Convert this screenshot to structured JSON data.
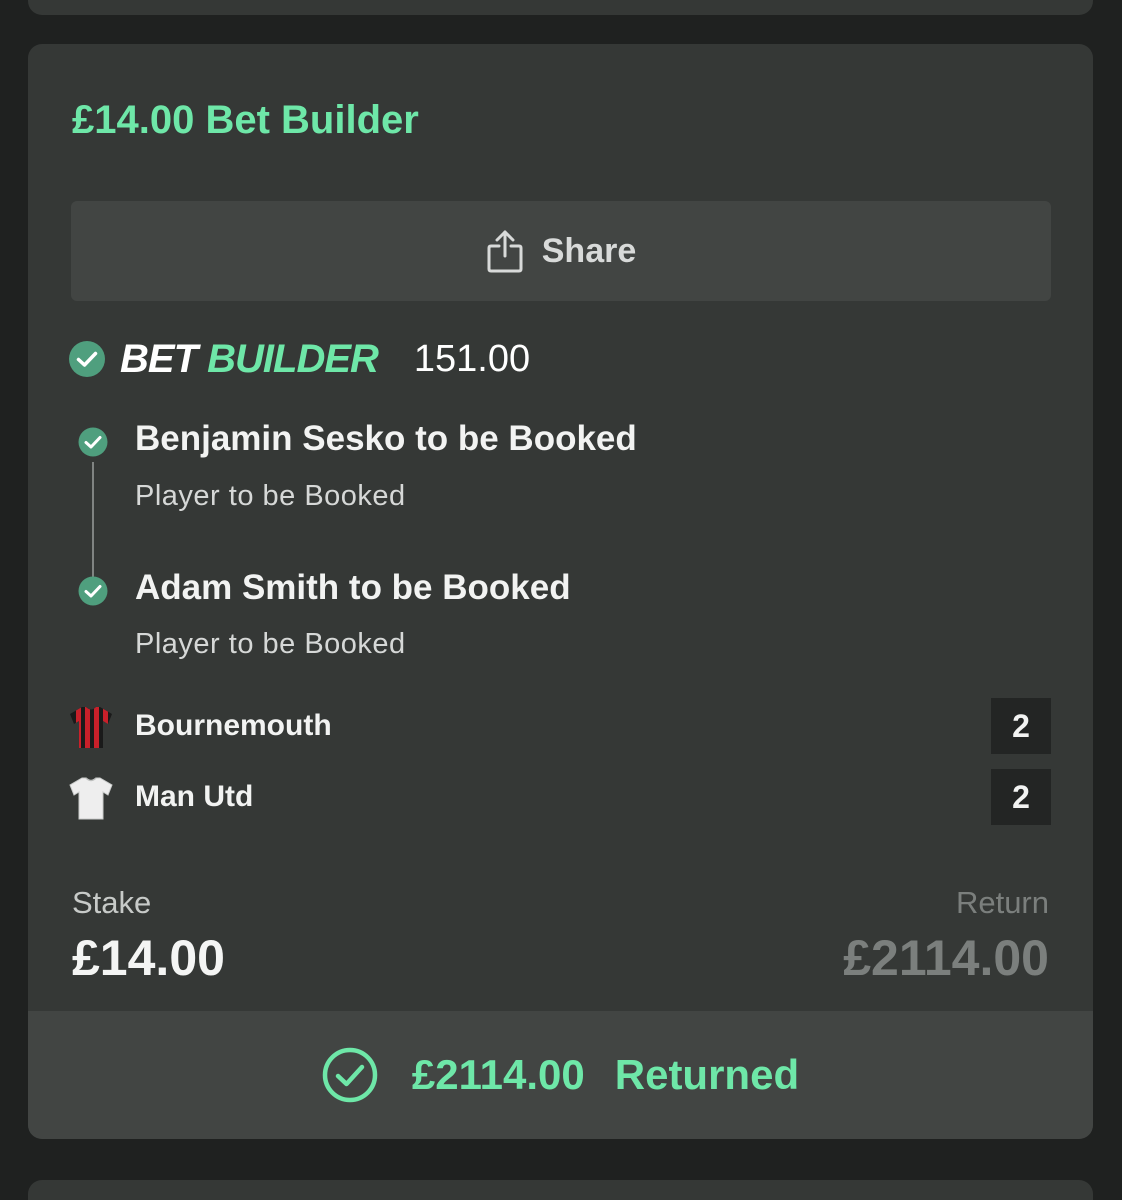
{
  "bet": {
    "title": "£14.00 Bet Builder",
    "share_label": "Share",
    "logo_word1": "BET",
    "logo_word2": "BUILDER",
    "odds": "151.00",
    "legs": [
      {
        "title": "Benjamin Sesko to be Booked",
        "market": "Player to be Booked"
      },
      {
        "title": "Adam Smith to be Booked",
        "market": "Player to be Booked"
      }
    ],
    "teams": [
      {
        "name": "Bournemouth",
        "score": "2",
        "shirt": "red-black-striped-shirt-icon"
      },
      {
        "name": "Man Utd",
        "score": "2",
        "shirt": "white-shirt-icon"
      }
    ],
    "stake_label": "Stake",
    "stake_value": "£14.00",
    "return_label": "Return",
    "return_value": "£2114.00",
    "returned_amount": "£2114.00",
    "returned_text": "Returned"
  },
  "colors": {
    "accent_green": "#6ee7a8",
    "check_green": "#4f9f7e",
    "card_bg": "#353836",
    "page_bg": "#1f2120"
  }
}
